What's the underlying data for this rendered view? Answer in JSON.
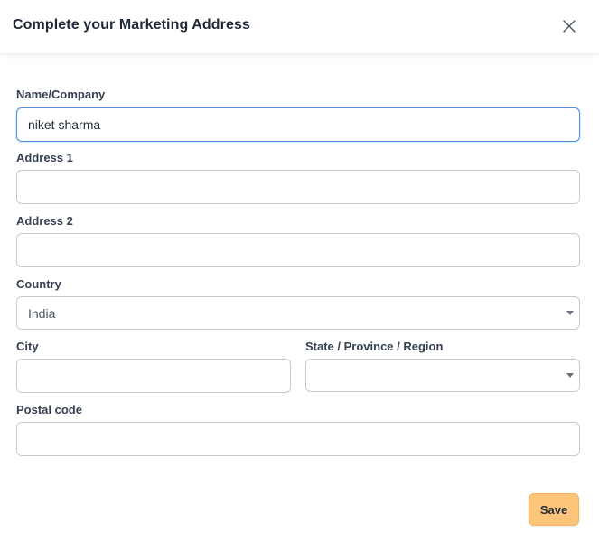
{
  "dialog": {
    "title": "Complete your Marketing Address",
    "close_icon": "close-icon"
  },
  "form": {
    "name": {
      "label": "Name/Company",
      "value": "niket sharma"
    },
    "address1": {
      "label": "Address 1",
      "value": ""
    },
    "address2": {
      "label": "Address 2",
      "value": ""
    },
    "country": {
      "label": "Country",
      "value": "India"
    },
    "city": {
      "label": "City",
      "value": ""
    },
    "state": {
      "label": "State / Province / Region",
      "value": ""
    },
    "postal": {
      "label": "Postal code",
      "value": ""
    }
  },
  "actions": {
    "save_label": "Save"
  },
  "colors": {
    "focus_border": "#4a8fe7",
    "input_border": "#c7ccd3",
    "save_bg": "#fdc57a"
  }
}
